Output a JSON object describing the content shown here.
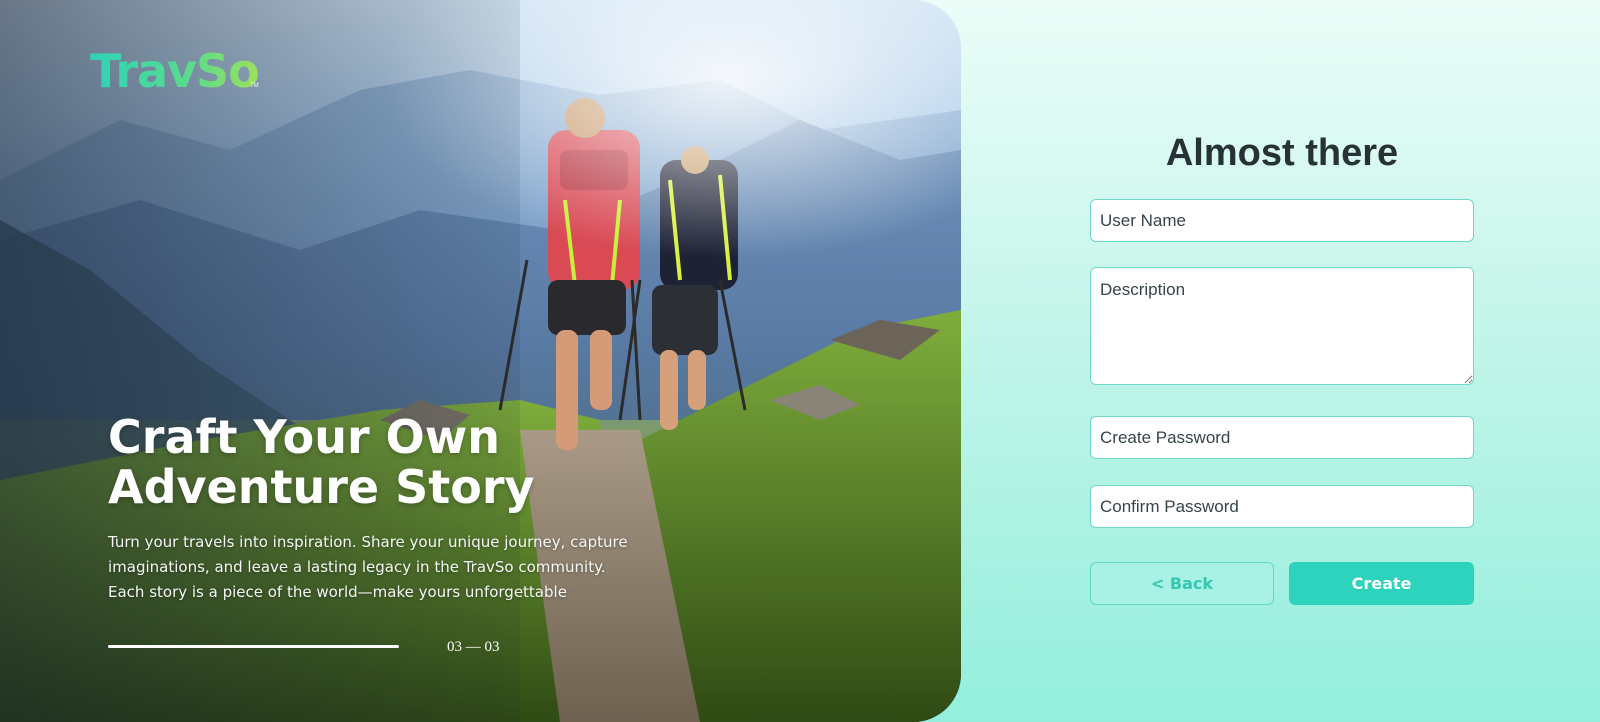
{
  "brand": {
    "logo_text": "TravSo",
    "trademark": "TM",
    "accent": "#2dd3bc"
  },
  "hero": {
    "title_line1": "Craft Your Own",
    "title_line2": "Adventure Story",
    "description": "Turn your travels into inspiration. Share your unique journey, capture imaginations, and leave a lasting legacy in the TravSo community. Each story is a piece of the world—make yours unforgettable",
    "step_counter": "03 — 03",
    "image": "two-hikers-mountain-trail"
  },
  "form": {
    "title": "Almost there",
    "user_name_placeholder": "User Name",
    "description_placeholder": "Description",
    "create_password_placeholder": "Create Password",
    "confirm_password_placeholder": "Confirm Password",
    "back_label": "< Back",
    "create_label": "Create"
  }
}
